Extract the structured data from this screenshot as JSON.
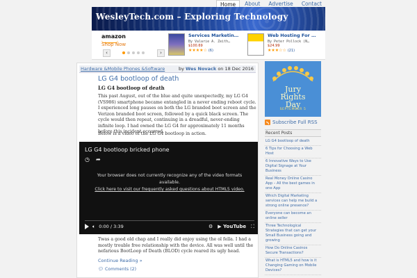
{
  "nav": {
    "items": [
      {
        "label": "Home",
        "active": true
      },
      {
        "label": "About",
        "active": false
      },
      {
        "label": "Advertise",
        "active": false
      },
      {
        "label": "Contact",
        "active": false
      }
    ]
  },
  "header": {
    "title": "WesleyTech.com – Exploring Technology"
  },
  "ads": {
    "amazon_logo": "amazon",
    "shop_now": "Shop Now",
    "prev": "‹",
    "next": "›",
    "products": [
      {
        "title": "Services Marketin…",
        "author": "By Valarie A. Zeith…",
        "price": "$100.69",
        "stars": "★★★★☆",
        "count": "(6)"
      },
      {
        "title": "Web Hosting For …",
        "author": "By Peter Pollock (N…",
        "price": "$24.99",
        "stars": "★★★☆☆",
        "count": "(21)"
      }
    ]
  },
  "post": {
    "categories": "Hardware &Mobile Phones &Software",
    "by_prefix": "by",
    "author": "Wes Novack",
    "date": "on 18 Dec 2016",
    "title": "LG G4 bootloop of death",
    "subtitle": "LG G4 bootloop of death",
    "para1": "This past August, out of the blue and quite unexpectedly, my LG G4 (VS986) smartphone became entangled in a never ending reboot cycle. I experienced long pauses on both the LG branded boot screen and the Verizon branded boot screen, followed by a quick black screen. The cycle would then repeat, continuing in a dreadful, never-ending infinite loop. I had owned the LG G4 for approximately 11 months before this incident occurred.",
    "para2": "Below is a video of the LG G4 bootloop in action.",
    "video": {
      "title": "LG G4 bootloop bricked phone",
      "msg": "Your browser does not currently recognize any of the video formats available.",
      "link": "Click here to visit our frequently asked questions about HTML5 video.",
      "time": "0:00 / 3:39",
      "yt": "▶ YouTube"
    },
    "para3": "Twas a good old chap and I really did enjoy using the ol fella. I had a mostly trouble free relationship with the device. All was well until the nefarious BootLoop of Death (BLOD) cycle reared its ugly head.",
    "continue": "Continue Reading »",
    "comments": "Comments (2)"
  },
  "sidebar": {
    "jury_line1": "Jury",
    "jury_line2": "Rights",
    "jury_line3": "Day",
    "jury_sub": "SEPTEMBER 5",
    "rss": "Subscribe Full RSS",
    "recent_title": "Recent Posts",
    "recent": [
      "LG G4 bootloop of death",
      "6 Tips for Choosing a Web Host",
      "6 Innovative Ways to Use Digital Signage at Your Business",
      "Real Money Online Casino App – All the best games in one App",
      "Which Digital Marketing services can help me build a strong online presence?",
      "Everyone can become an online seller",
      "Three Technological Strategies that can get your Small Business going and growing",
      "How Do Online Casinos Secure Transactions?",
      "What is HTML5 and how is it Changing Gaming on Mobile Devices?"
    ]
  },
  "colors": {
    "link": "#3e6ca8",
    "header_dark": "#0a1a4a",
    "jury_bg": "#4a8fd6",
    "rss": "#f68a1e"
  }
}
